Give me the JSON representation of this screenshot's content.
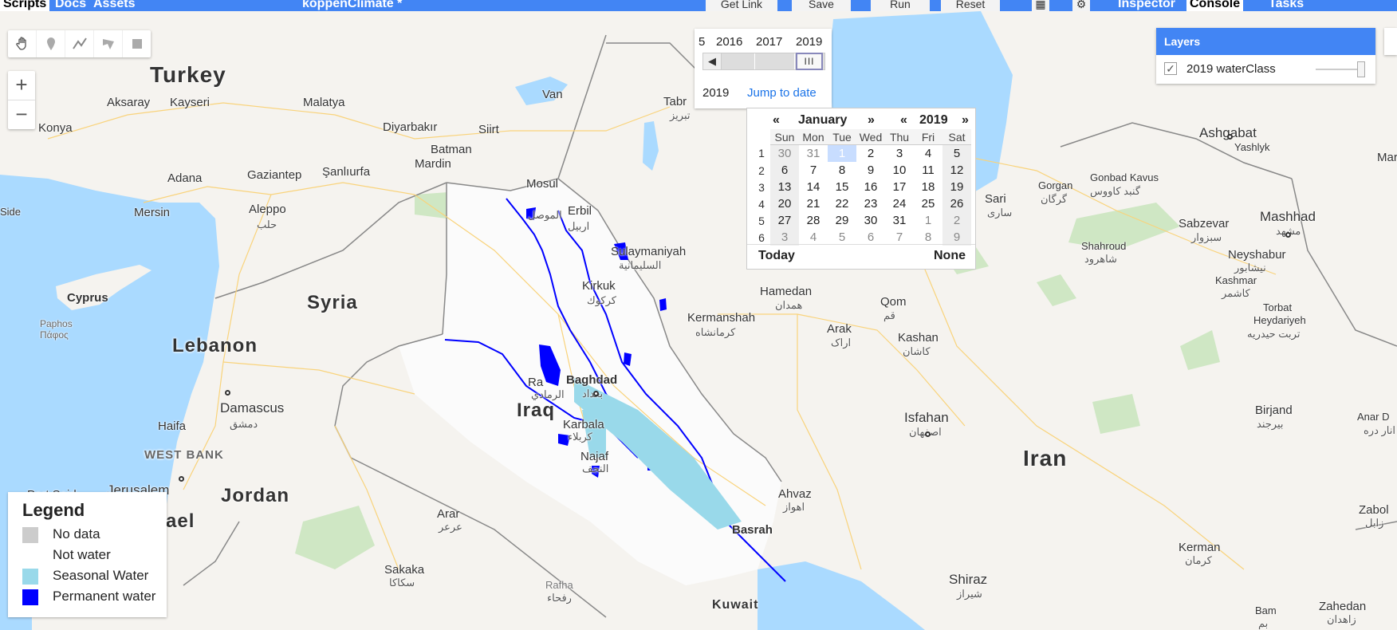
{
  "topbar": {
    "tab_scripts": "Scripts",
    "tab_docs": "Docs",
    "tab_assets": "Assets",
    "script_name": "koppenClimate *",
    "get_link": "Get Link",
    "save": "Save",
    "run": "Run",
    "reset": "Reset",
    "tab_inspector": "Inspector",
    "tab_console": "Console",
    "tab_tasks": "Tasks"
  },
  "map_labels": {
    "countries": {
      "turkey": "Turkey",
      "syria": "Syria",
      "lebanon": "Lebanon",
      "iraq": "Iraq",
      "iran": "Iran",
      "jordan": "Jordan",
      "israel": "ael",
      "west_bank": "WEST BANK",
      "kuwait": "Kuwait"
    },
    "cities": {
      "kayseri": "Kayseri",
      "aksaray": "Aksaray",
      "konya": "Konya",
      "malatya": "Malatya",
      "van": "Van",
      "tabriz": "Tabr",
      "tabriz_ar": "تبریز",
      "diyarbakir": "Diyarbakır",
      "batman": "Batman",
      "siirt": "Siirt",
      "mardin": "Mardin",
      "adana": "Adana",
      "gaziantep": "Gaziantep",
      "sanliurfa": "Şanlıurfa",
      "mersin": "Mersin",
      "aleppo": "Aleppo",
      "aleppo_ar": "حلب",
      "side": "Side",
      "mosul": "Mosul",
      "mosul_ar": "الموصل",
      "erbil": "Erbil",
      "erbil_ar": "اربيل",
      "sulaymaniyah": "Sulaymaniyah",
      "sulaymaniyah_ar": "السليمانية",
      "kirkuk": "Kirkuk",
      "kirkuk_ar": "كركوك",
      "cyprus": "Cyprus",
      "paphos": "Paphos",
      "paphos_gr": "Πάφος",
      "hamedan": "Hamedan",
      "hamedan_ar": "همدان",
      "kermanshah": "Kermanshah",
      "kermanshah_ar": "كرمانشاه",
      "arak": "Arak",
      "arak_ar": "اراک",
      "qom": "Qom",
      "qom_ar": "قم",
      "kashan": "Kashan",
      "kashan_ar": "کاشان",
      "sari": "Sari",
      "sari_ar": "ساری",
      "gorgan": "Gorgan",
      "gorgan_ar": "گرگان",
      "gonbad": "Gonbad Kavus",
      "gonbad_ar": "گنبد کاووس",
      "ashgabat": "Ashgabat",
      "yashlyk": "Yashlyk",
      "sabzevar": "Sabzevar",
      "sabzevar_ar": "سبزوار",
      "mashhad": "Mashhad",
      "mashhad_ar": "مشهد",
      "neyshabur": "Neyshabur",
      "neyshabur_ar": "نیشابور",
      "kashmar": "Kashmar",
      "kashmar_ar": "کاشمر",
      "torbat": "Torbat",
      "torbat2": "Heydariyeh",
      "torbat_ar": "تربت حیدریه",
      "shahroud": "Shahroud",
      "shahroud_ar": "شاهرود",
      "mari": "Mari",
      "baghdad": "Baghdad",
      "baghdad_ar": "بغداد",
      "ramadi": "Ra",
      "ramadi_ar": "الرمادي",
      "karbala": "Karbala",
      "karbala_ar": "كربلاء",
      "najaf": "Najaf",
      "najaf_ar": "النجف",
      "isfahan": "Isfahan",
      "isfahan_ar": "اصفهان",
      "birjand": "Birjand",
      "birjand_ar": "بیرجند",
      "anar": "Anar D",
      "anar_ar": "انار دره",
      "damascus": "Damascus",
      "damascus_ar": "دمشق",
      "haifa": "Haifa",
      "jerusalem": "Jerusalem",
      "port_said": "Port Said",
      "arar": "Arar",
      "arar_ar": "عرعر",
      "ahvaz": "Ahvaz",
      "ahvaz_ar": "اهواز",
      "basrah": "Basrah",
      "sakaka": "Sakaka",
      "sakaka_ar": "سكاكا",
      "rafha": "Rafha",
      "rafha_ar": "رفحاء",
      "shiraz": "Shiraz",
      "shiraz_ar": "شیراز",
      "kerman": "Kerman",
      "kerman_ar": "کرمان",
      "bam": "Bam",
      "bam_ar": "بم",
      "zahedan": "Zahedan",
      "zahedan_ar": "زاهدان",
      "zabol": "Zabol",
      "zabol_ar": "زابل"
    }
  },
  "time_slider": {
    "years": [
      "5",
      "2016",
      "2017",
      "2019"
    ],
    "handle_label": "III",
    "selected_year": "2019",
    "jump_link": "Jump to date"
  },
  "calendar": {
    "prev_month": "«",
    "month": "January",
    "next_month": "»",
    "prev_year": "«",
    "year": "2019",
    "next_year": "»",
    "weekdays": [
      "Sun",
      "Mon",
      "Tue",
      "Wed",
      "Thu",
      "Fri",
      "Sat"
    ],
    "week_numbers": [
      "1",
      "2",
      "3",
      "4",
      "5",
      "6"
    ],
    "days": [
      [
        "30",
        "31",
        "1",
        "2",
        "3",
        "4",
        "5"
      ],
      [
        "6",
        "7",
        "8",
        "9",
        "10",
        "11",
        "12"
      ],
      [
        "13",
        "14",
        "15",
        "16",
        "17",
        "18",
        "19"
      ],
      [
        "20",
        "21",
        "22",
        "23",
        "24",
        "25",
        "26"
      ],
      [
        "27",
        "28",
        "29",
        "30",
        "31",
        "1",
        "2"
      ],
      [
        "3",
        "4",
        "5",
        "6",
        "7",
        "8",
        "9"
      ]
    ],
    "today": "Today",
    "none": "None"
  },
  "layers_panel": {
    "title": "Layers",
    "checked": "✓",
    "layer_name": "2019 waterClass"
  },
  "legend": {
    "title": "Legend",
    "items": [
      {
        "label": "No data",
        "color": "#cccccc"
      },
      {
        "label": "Not water",
        "color": "#ffffff"
      },
      {
        "label": "Seasonal Water",
        "color": "#99d9ea"
      },
      {
        "label": "Permanent water",
        "color": "#0000ff"
      }
    ]
  },
  "colors": {
    "topbar": "#4285f4",
    "land": "#f5f3ef",
    "sea": "#aadaff",
    "permanent_water": "#0000ff",
    "seasonal_water": "#99d9ea"
  }
}
